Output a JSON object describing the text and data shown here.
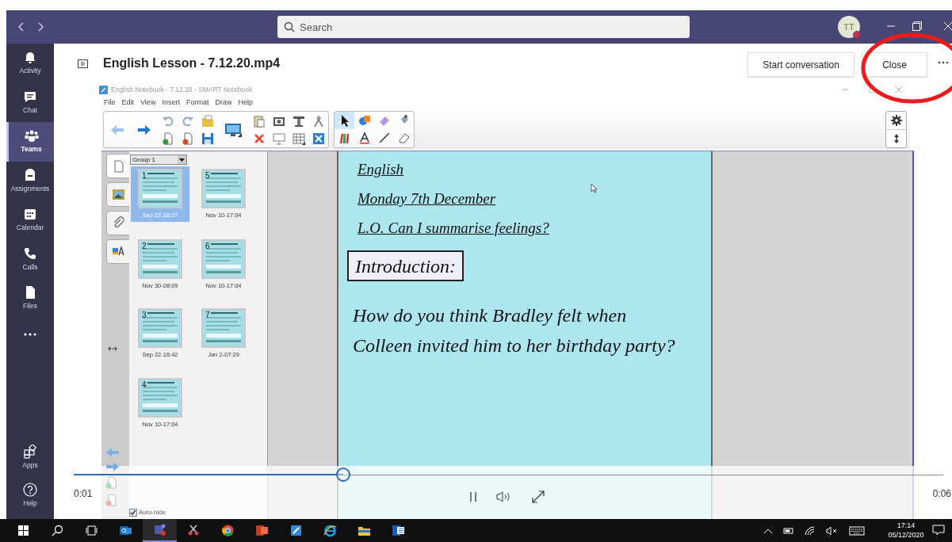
{
  "app_bar": {
    "search": {
      "placeholder": "Search"
    },
    "avatar": {
      "initials": "TT"
    }
  },
  "rail": {
    "items": [
      {
        "label": "Activity",
        "selected": false
      },
      {
        "label": "Chat",
        "selected": false
      },
      {
        "label": "Teams",
        "selected": true
      },
      {
        "label": "Assignments",
        "selected": false
      },
      {
        "label": "Calendar",
        "selected": false
      },
      {
        "label": "Calls",
        "selected": false
      },
      {
        "label": "Files",
        "selected": false
      }
    ],
    "bottom_items": [
      {
        "label": "Apps"
      },
      {
        "label": "Help"
      }
    ]
  },
  "header": {
    "title": "English Lesson - 7.12.20.mp4",
    "buttons": [
      "Start conversation",
      "Close"
    ]
  },
  "notebook": {
    "title": "English Notebook - 7.12.20 - SMART Notebook",
    "menu": [
      "File",
      "Edit",
      "View",
      "Insert",
      "Format",
      "Draw",
      "Help"
    ],
    "group": "Group 1",
    "pages": [
      {
        "number": "1",
        "date": "Sep 22-16:27",
        "selected": true
      },
      {
        "number": "5",
        "date": "Nov 10-17:04",
        "selected": false
      },
      {
        "number": "2",
        "date": "Nov 30-08:09",
        "selected": false
      },
      {
        "number": "6",
        "date": "Nov 10-17:04",
        "selected": false
      },
      {
        "number": "3",
        "date": "Sep 22-16:42",
        "selected": false
      },
      {
        "number": "7",
        "date": "Jan 2-07:29",
        "selected": false
      },
      {
        "number": "4",
        "date": "Nov 10-17:04",
        "selected": false
      }
    ],
    "auto_hide": {
      "label": "Auto-hide",
      "checked": true
    },
    "slide": {
      "headings": [
        "English",
        "Monday 7th December",
        "L.O. Can I summarise feelings?"
      ],
      "box": "Introduction:",
      "question": "How do you think Bradley felt when Colleen invited him to her birthday party?"
    }
  },
  "player": {
    "level": 0.31,
    "elapsed": "0:01",
    "duration": "0:06"
  },
  "taskbar": {
    "time": "17:14",
    "date": "05/12/2020"
  }
}
